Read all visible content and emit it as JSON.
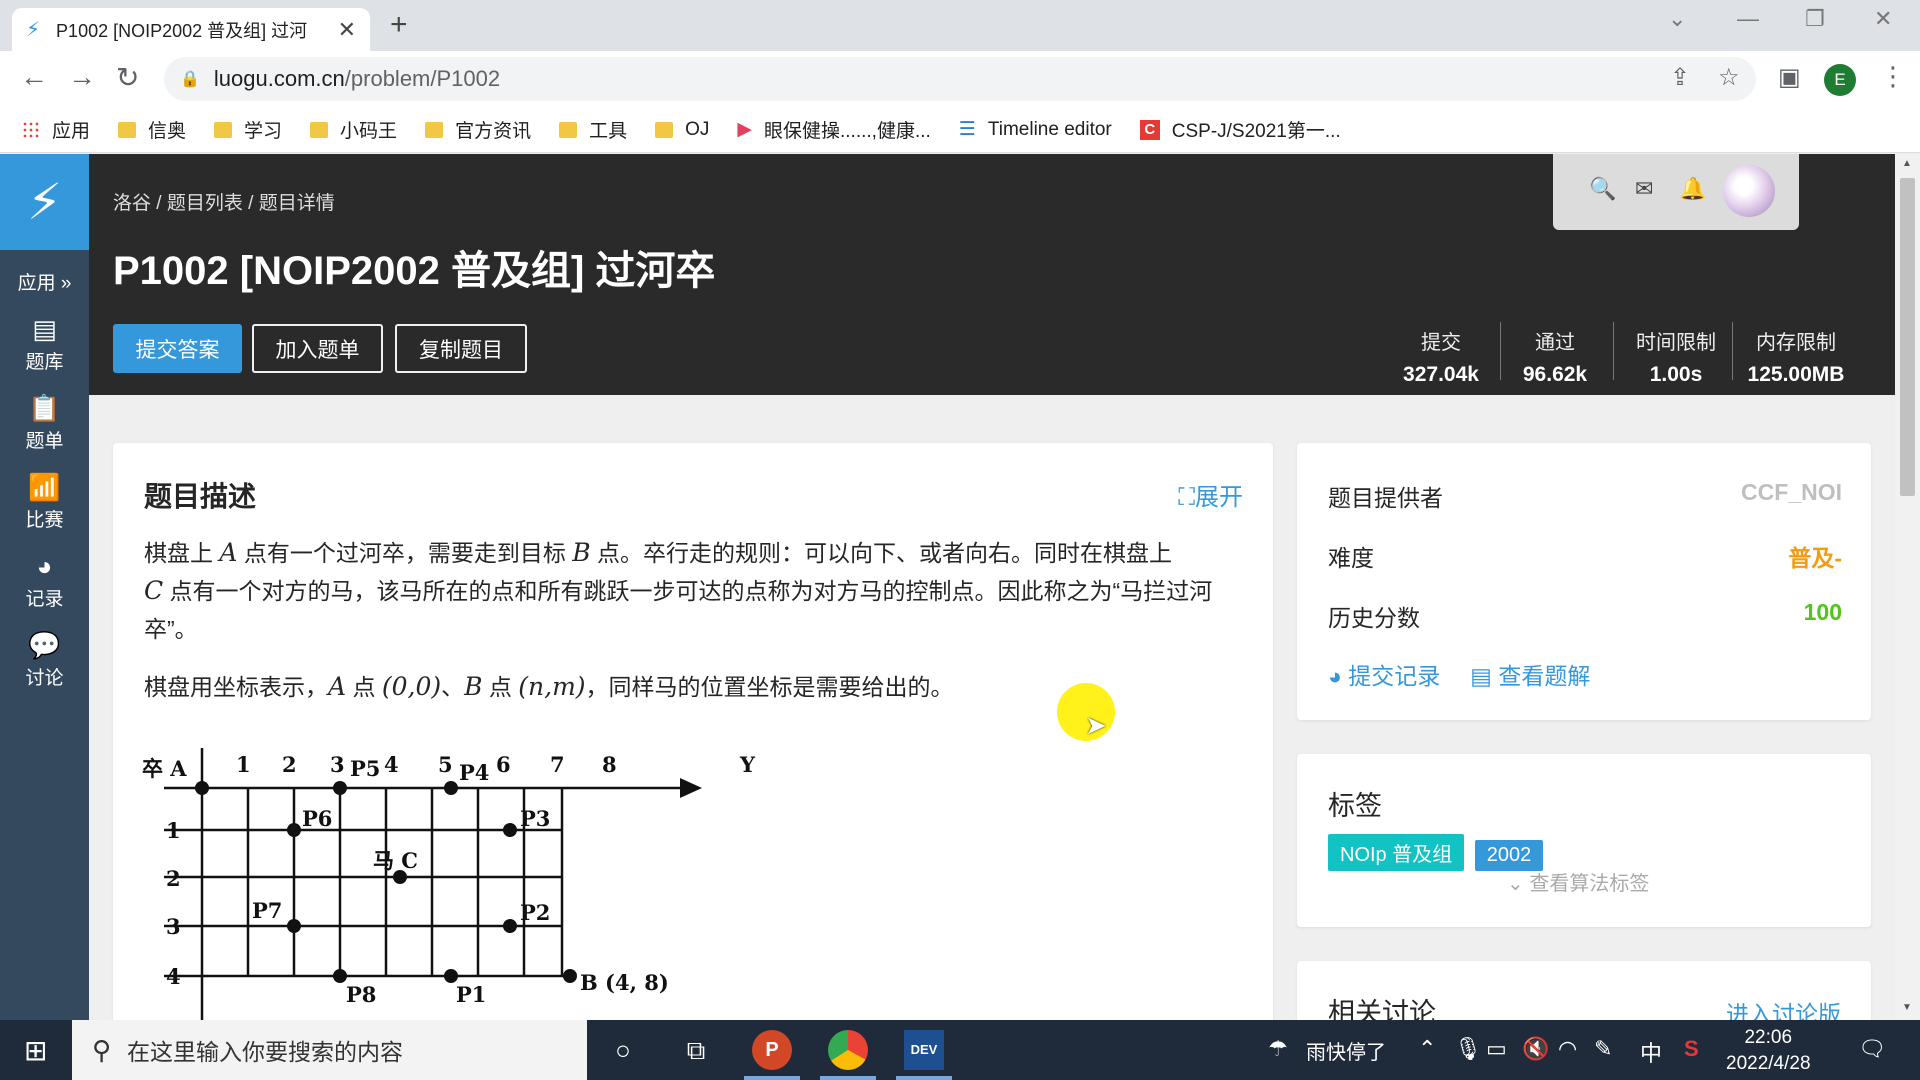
{
  "browser": {
    "tab_title": "P1002 [NOIP2002 普及组] 过河",
    "url_host": "luogu.com.cn",
    "url_path": "/problem/P1002",
    "profile_initial": "E",
    "bookmarks": [
      {
        "label": "应用",
        "icon": "apps-grid-icon"
      },
      {
        "label": "信奥",
        "icon": "folder-icon"
      },
      {
        "label": "学习",
        "icon": "folder-icon"
      },
      {
        "label": "小码王",
        "icon": "folder-icon"
      },
      {
        "label": "官方资讯",
        "icon": "folder-icon"
      },
      {
        "label": "工具",
        "icon": "folder-icon"
      },
      {
        "label": "OJ",
        "icon": "folder-icon"
      },
      {
        "label": "眼保健操......,健康...",
        "icon": "video-icon"
      },
      {
        "label": "Timeline editor",
        "icon": "timeline-icon"
      },
      {
        "label": "CSP-J/S2021第一...",
        "icon": "csp-icon"
      }
    ]
  },
  "sidebar": {
    "apps_label": "应用 »",
    "items": [
      {
        "label": "题库",
        "icon": "book-icon"
      },
      {
        "label": "题单",
        "icon": "clipboard-icon"
      },
      {
        "label": "比赛",
        "icon": "bar-chart-icon"
      },
      {
        "label": "记录",
        "icon": "pie-chart-icon"
      },
      {
        "label": "讨论",
        "icon": "chat-icon"
      }
    ]
  },
  "header": {
    "breadcrumb": [
      "洛谷",
      "题目列表",
      "题目详情"
    ],
    "title": "P1002 [NOIP2002 普及组] 过河卒",
    "buttons": {
      "submit": "提交答案",
      "add_list": "加入题单",
      "copy": "复制题目"
    },
    "stats": [
      {
        "label": "提交",
        "value": "327.04k"
      },
      {
        "label": "通过",
        "value": "96.62k"
      },
      {
        "label": "时间限制",
        "value": "1.00s"
      },
      {
        "label": "内存限制",
        "value": "125.00MB"
      }
    ]
  },
  "description": {
    "heading": "题目描述",
    "expand": "展开",
    "p1_a": "棋盘上 ",
    "A": "A",
    "p1_b": " 点有一个过河卒，需要走到目标 ",
    "B": "B",
    "p1_c": " 点。卒行走的规则：可以向下、或者向右。同时在棋盘上",
    "C": "C",
    "p1_d": " 点有一个对方的马，该马所在的点和所有跳跃一步可达的点称为对方马的控制点。因此称之为“马拦过河卒”。",
    "p2_a": "棋盘用坐标表示，",
    "p2_b": " 点 ",
    "p2_A_coord": "(0,0)",
    "p2_c": "、",
    "p2_d": " 点 ",
    "p2_B_coord": "(n,m)",
    "p2_e": "，同样马的位置坐标是需要给出的。",
    "figure": {
      "col_labels": [
        "1",
        "2",
        "3",
        "4",
        "5",
        "6",
        "7",
        "8"
      ],
      "row_labels": [
        "1",
        "2",
        "3",
        "4"
      ],
      "corner": "卒 A",
      "axis_y": "Y",
      "horse": "马 C",
      "target": "B (4, 8)",
      "points": [
        "P1",
        "P2",
        "P3",
        "P4",
        "P5",
        "P6",
        "P7",
        "P8"
      ]
    }
  },
  "info": {
    "provider_label": "题目提供者",
    "provider_value": "CCF_NOI",
    "difficulty_label": "难度",
    "difficulty_value": "普及-",
    "score_label": "历史分数",
    "score_value": "100",
    "link_records": "提交记录",
    "link_solutions": "查看题解",
    "colors": {
      "difficulty": "#f39c11",
      "score": "#52c41a",
      "provider": "#bfbfbf"
    }
  },
  "tags": {
    "heading": "标签",
    "items": [
      {
        "label": "NOIp 普及组",
        "color": "#13c2c2"
      },
      {
        "label": "2002",
        "color": "#3498db"
      }
    ],
    "more": "查看算法标签"
  },
  "discussion": {
    "heading": "相关讨论",
    "link": "进入讨论版"
  },
  "taskbar": {
    "search_placeholder": "在这里输入你要搜索的内容",
    "weather": "雨快停了",
    "ime": "中",
    "time": "22:06",
    "date": "2022/4/28"
  }
}
